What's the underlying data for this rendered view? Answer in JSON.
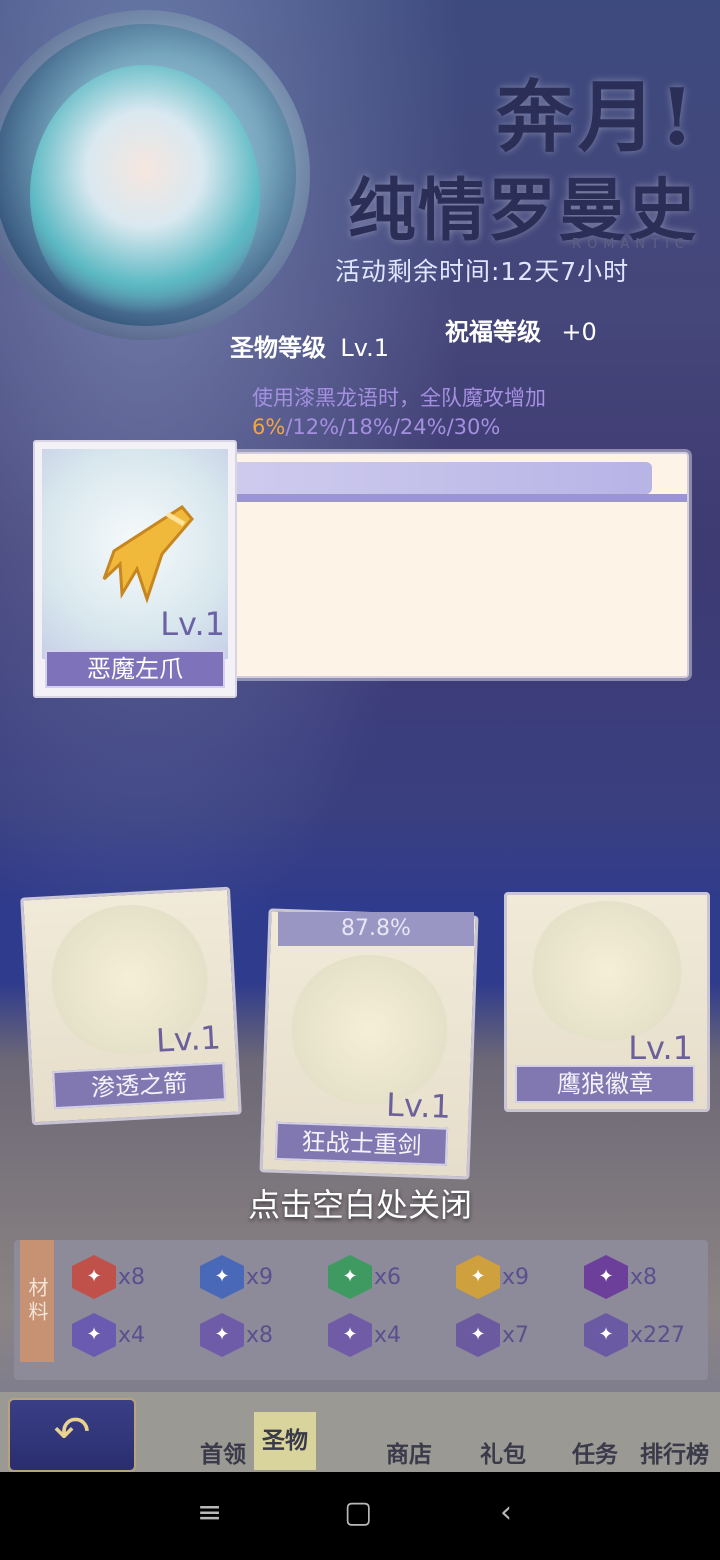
{
  "banner": {
    "title_line1": "奔月!",
    "title_line2": "纯情罗曼史",
    "title_sub": "ROMANTIC",
    "timer_text": "活动剩余时间:12天7小时"
  },
  "stats": {
    "relic_level_label": "圣物等级",
    "relic_level_value": "Lv.1",
    "blessing_level_label": "祝福等级",
    "blessing_level_value": "+0"
  },
  "effect": {
    "prefix": "使用漆黑龙语时，全队魔攻增加",
    "highlight": "6%",
    "suffix": "/12%/18%/24%/30%"
  },
  "selected_item": {
    "name": "恶魔左爪",
    "level": "Lv.1"
  },
  "cards": [
    {
      "name": "渗透之箭",
      "level": "Lv.1"
    },
    {
      "name": "狂战士重剑",
      "level": "Lv.1",
      "progress": "87.8%"
    },
    {
      "name": "鹰狼徽章",
      "level": "Lv.1"
    }
  ],
  "close_hint": "点击空白处关闭",
  "materials": {
    "label": "材料",
    "items": [
      {
        "icon": "triangle-eye-icon",
        "count": "x8",
        "color": "#c0504a"
      },
      {
        "icon": "trinity-knot-icon",
        "count": "x9",
        "color": "#4a68b8"
      },
      {
        "icon": "leaf-star-icon",
        "count": "x6",
        "color": "#3f9a62"
      },
      {
        "icon": "sun-star-icon",
        "count": "x9",
        "color": "#cfa03e"
      },
      {
        "icon": "crescent-x-icon",
        "count": "x8",
        "color": "#6c3f9a"
      },
      {
        "icon": "sword-icon",
        "count": "x4",
        "color": "#6a5ab0"
      },
      {
        "icon": "spiral-icon",
        "count": "x8",
        "color": "#6e5ca8"
      },
      {
        "icon": "magnifier-rune-icon",
        "count": "x4",
        "color": "#705ca6"
      },
      {
        "icon": "broken-shield-icon",
        "count": "x7",
        "color": "#6b5aa0"
      },
      {
        "icon": "crown-wings-icon",
        "count": "x227",
        "color": "#6a5aa4"
      }
    ]
  },
  "nav": {
    "back_icon": "back-arrow-icon",
    "tabs": [
      "首领",
      "圣物",
      "商店",
      "礼包",
      "任务",
      "排行榜"
    ],
    "active_tab": "圣物"
  },
  "system_nav": {
    "menu": "≡",
    "home": "▢",
    "back": "‹"
  }
}
